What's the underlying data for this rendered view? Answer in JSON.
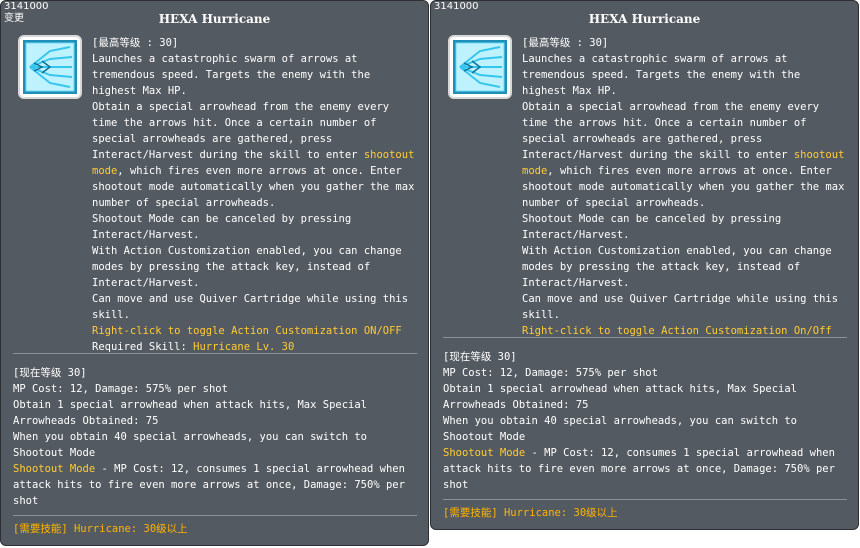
{
  "left": {
    "skill_id": "3141000",
    "change_label": "变更",
    "title": "HEXA Hurricane",
    "icon": "hurricane-skill-icon",
    "max_level": "[最高等级 : 30]",
    "desc_1": "Launches a catastrophic swarm of arrows at tremendous speed. Targets the enemy with the highest Max HP.",
    "desc_2a": "Obtain a special arrowhead from the enemy every time the arrows hit. Once a certain number of special arrowheads are gathered, press Interact/Harvest during the skill to enter ",
    "shootout_mode": "shootout mode",
    "desc_2b": ", which fires even more arrows at once. Enter shootout mode automatically when you gather the max number of special arrowheads.",
    "desc_3": "Shootout Mode can be canceled by pressing Interact/Harvest.",
    "desc_4": "With Action Customization enabled, you can change modes by pressing the attack key, instead of Interact/Harvest.",
    "desc_5": "Can move and use Quiver Cartridge while using this skill.",
    "toggle_hint": "Right-click to toggle Action Customization ON/OFF",
    "required_skill_label": "Required Skill: ",
    "required_skill_value": "Hurricane Lv. 30",
    "current_level": "[现在等级 30]",
    "cur_1": "MP Cost: 12, Damage: 575% per shot",
    "cur_2": "Obtain 1 special arrowhead when attack hits, Max Special Arrowheads Obtained: 75",
    "cur_3": "When you obtain 40 special arrowheads, you can switch to Shootout Mode",
    "cur_4_mode": "Shootout Mode",
    "cur_4_text": " - MP Cost: 12, consumes 1 special arrowhead when attack hits to fire even more arrows at once, Damage: 750% per shot",
    "required": "[需要技能] Hurricane: 30级以上"
  },
  "right": {
    "skill_id": "3141000",
    "title": "HEXA Hurricane",
    "icon": "hurricane-skill-icon",
    "max_level": "[最高等级 : 30]",
    "desc_1": "Launches a catastrophic swarm of arrows at tremendous speed. Targets the enemy with the highest Max HP.",
    "desc_2a": "Obtain a special arrowhead from the enemy every time the arrows hit. Once a certain number of special arrowheads are gathered, press Interact/Harvest during the skill to enter ",
    "shootout_mode": "shootout mode",
    "desc_2b": ", which fires even more arrows at once. Enter shootout mode automatically when you gather the max number of special arrowheads.",
    "desc_3": "Shootout Mode can be canceled by pressing Interact/Harvest.",
    "desc_4": "With Action Customization enabled, you can change modes by pressing the attack key, instead of Interact/Harvest.",
    "desc_5": "Can move and use Quiver Cartridge while using this skill.",
    "toggle_hint": "Right-click to toggle Action Customization On/Off",
    "current_level": "[现在等级 30]",
    "cur_1": "MP Cost: 12, Damage: 575% per shot",
    "cur_2": "Obtain 1 special arrowhead when attack hits, Max Special Arrowheads Obtained: 75",
    "cur_3": "When you obtain 40 special arrowheads, you can switch to Shootout Mode",
    "cur_4_mode": "Shootout Mode",
    "cur_4_text": " - MP Cost: 12, consumes 1 special arrowhead when attack hits to fire even more arrows at once, Damage: 750% per shot",
    "required": "[需要技能] Hurricane: 30级以上"
  },
  "colors": {
    "panel_bg": "#545a61",
    "highlight": "#ffcc33",
    "required": "#ffb400",
    "icon_cyan": "#35c6ee"
  }
}
